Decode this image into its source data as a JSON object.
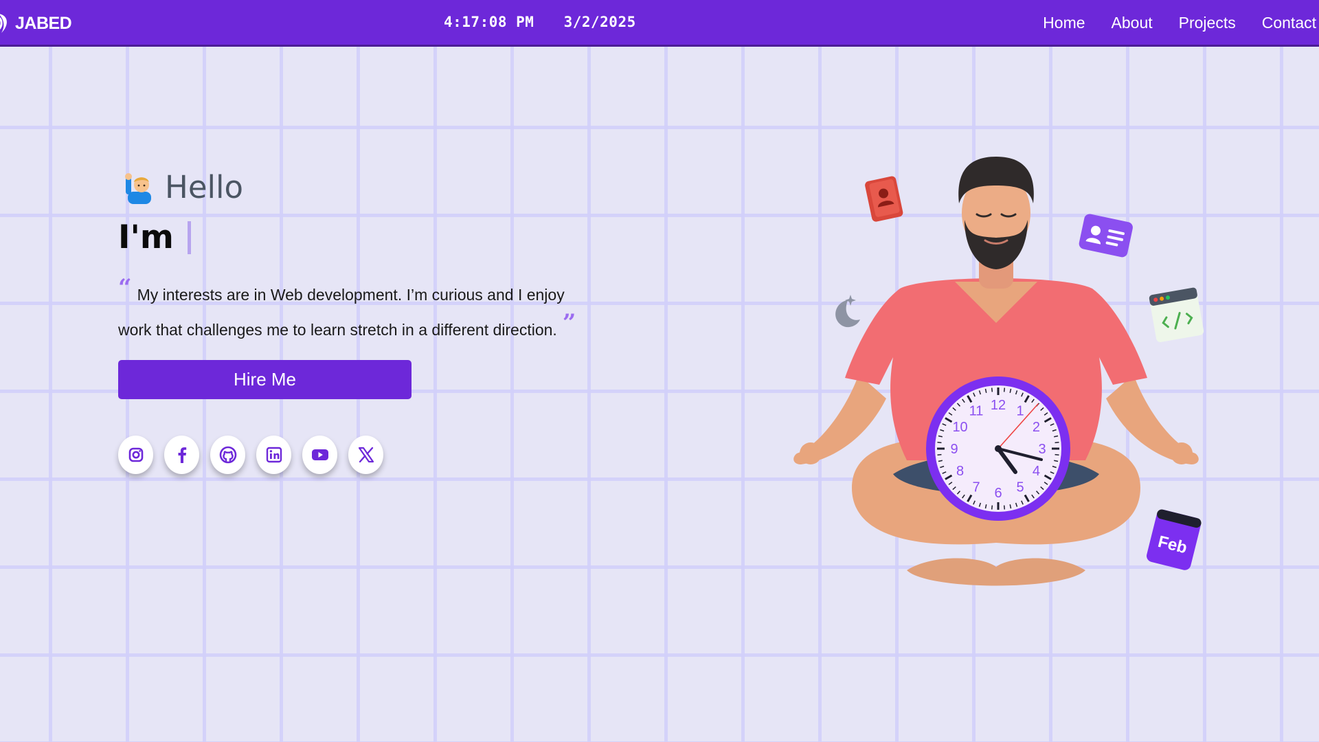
{
  "navbar": {
    "logo_text": "JABED",
    "time": "4:17:08 PM",
    "date": "3/2/2025",
    "links": [
      "Home",
      "About",
      "Projects",
      "Contact"
    ]
  },
  "hero": {
    "greeting": "Hello",
    "intro": "I'm",
    "quote": "My interests are in Web development. I’m curious and I enjoy work that challenges me to learn stretch in a different direction.",
    "hire_button": "Hire Me",
    "socials": [
      "instagram-icon",
      "facebook-icon",
      "github-icon",
      "linkedin-icon",
      "youtube-icon",
      "x-icon"
    ]
  },
  "illustration": {
    "month_label": "Feb",
    "clock_numbers": [
      "12",
      "1",
      "2",
      "3",
      "4",
      "5",
      "6",
      "7",
      "8",
      "9",
      "10",
      "11"
    ]
  },
  "colors": {
    "primary": "#6d28d9",
    "background": "#e6e5f6",
    "grid": "#d2d0fa"
  }
}
